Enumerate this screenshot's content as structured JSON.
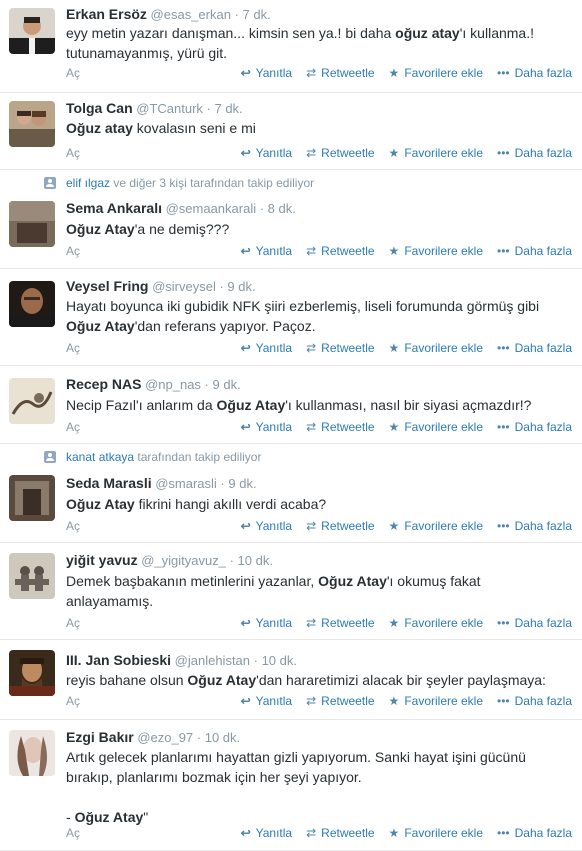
{
  "actions": {
    "expand": "Aç",
    "reply": "Yanıtla",
    "retweet": "Retweetle",
    "favorite": "Favorilere ekle",
    "more": "Daha fazla"
  },
  "colors": {
    "link": "#2b7bb9",
    "muted": "#8899a6",
    "text": "#292f33",
    "separator": "#e8e8e8"
  },
  "icons": {
    "reply": "reply-arrow-icon",
    "retweet": "retweet-icon",
    "favorite": "star-icon",
    "more": "ellipsis-icon",
    "context": "follow-person-icon"
  },
  "tweets": [
    {
      "fullname": "Erkan Ersöz",
      "username": "@esas_erkan",
      "time": "7 dk.",
      "segments": [
        {
          "t": "eyy metin yazarı danışman... kimsin sen ya.! bi daha ",
          "b": false
        },
        {
          "t": "oğuz atay",
          "b": true
        },
        {
          "t": "'ı kullanma.! tutunamayanmış, yürü git.",
          "b": false
        }
      ]
    },
    {
      "fullname": "Tolga Can",
      "username": "@TCanturk",
      "time": "7 dk.",
      "segments": [
        {
          "t": "Oğuz atay",
          "b": true
        },
        {
          "t": " kovalasın seni e mi",
          "b": false
        }
      ]
    },
    {
      "context_user": "elif ılgaz",
      "context_text": "ve diğer 3 kişi tarafından takip ediliyor",
      "fullname": "Sema Ankaralı",
      "username": "@semaankarali",
      "time": "8 dk.",
      "segments": [
        {
          "t": "Oğuz Atay",
          "b": true
        },
        {
          "t": "'a ne demiş???",
          "b": false
        }
      ]
    },
    {
      "fullname": "Veysel Fring",
      "username": "@sirveysel",
      "time": "9 dk.",
      "segments": [
        {
          "t": "Hayatı boyunca iki gubidik NFK şiiri ezberlemiş, liseli forumunda görmüş gibi ",
          "b": false
        },
        {
          "t": "Oğuz Atay",
          "b": true
        },
        {
          "t": "'dan referans yapıyor. Paçoz.",
          "b": false
        }
      ]
    },
    {
      "fullname": "Recep NAS",
      "username": "@np_nas",
      "time": "9 dk.",
      "segments": [
        {
          "t": "Necip Fazıl'ı anlarım da ",
          "b": false
        },
        {
          "t": "Oğuz Atay",
          "b": true
        },
        {
          "t": "'ı kullanması, nasıl bir siyasi açmazdır!?",
          "b": false
        }
      ]
    },
    {
      "context_user": "kanat atkaya",
      "context_text": "tarafından takip ediliyor",
      "fullname": "Seda Marasli",
      "username": "@smarasli",
      "time": "9 dk.",
      "segments": [
        {
          "t": "Oğuz Atay",
          "b": true
        },
        {
          "t": " fikrini hangi akıllı verdi acaba?",
          "b": false
        }
      ]
    },
    {
      "fullname": "yiğit yavuz",
      "username": "@_yigityavuz_",
      "time": "10 dk.",
      "segments": [
        {
          "t": "Demek başbakanın metinlerini yazanlar, ",
          "b": false
        },
        {
          "t": "Oğuz Atay",
          "b": true
        },
        {
          "t": "'ı okumuş fakat anlayamamış.",
          "b": false
        }
      ]
    },
    {
      "fullname": "III. Jan Sobieski",
      "username": "@janlehistan",
      "time": "10 dk.",
      "segments": [
        {
          "t": "reyis bahane olsun ",
          "b": false
        },
        {
          "t": "Oğuz Atay",
          "b": true
        },
        {
          "t": "'dan hararetimizi alacak bir şeyler paylaşmaya:",
          "b": false
        }
      ]
    },
    {
      "fullname": "Ezgi Bakır",
      "username": "@ezo_97",
      "time": "10 dk.",
      "segments": [
        {
          "t": "Artık gelecek planlarımı hayattan gizli yapıyorum. Sanki hayat işini gücünü bırakıp, planlarımı bozmak için her şeyi yapıyor.",
          "b": false
        },
        {
          "t": "\n\n- ",
          "b": false
        },
        {
          "t": "Oğuz Atay",
          "b": true
        },
        {
          "t": "\"",
          "b": false
        }
      ]
    }
  ]
}
